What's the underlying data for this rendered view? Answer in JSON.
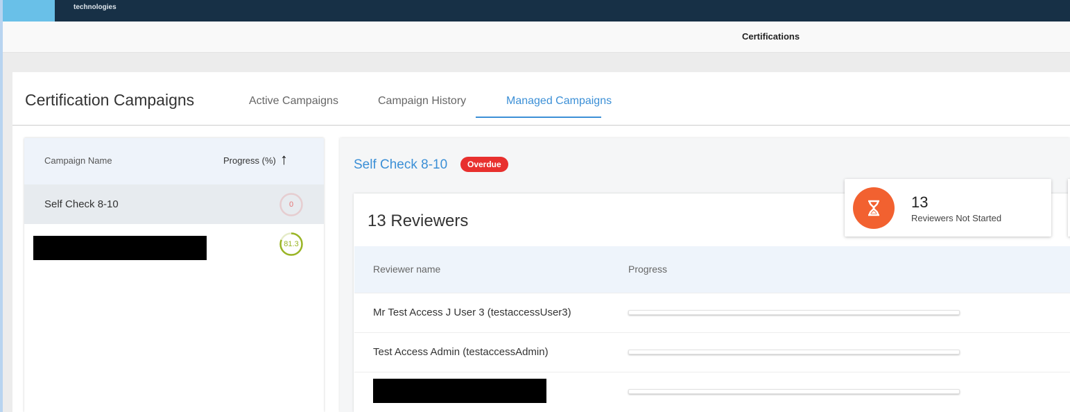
{
  "header": {
    "logo_text": "technologies",
    "section_title": "Certifications"
  },
  "page": {
    "title": "Certification Campaigns",
    "tabs": [
      {
        "label": "Active Campaigns"
      },
      {
        "label": "Campaign History"
      },
      {
        "label": "Managed Campaigns",
        "active": true
      }
    ]
  },
  "campaign_list": {
    "columns": {
      "name": "Campaign Name",
      "progress": "Progress (%)"
    },
    "sort_icon": "arrow-up-icon",
    "rows": [
      {
        "name": "Self Check 8-10",
        "progress": "0",
        "progress_value": 0,
        "color": "#e57373"
      },
      {
        "name": null,
        "redacted": true,
        "progress": "81.3",
        "progress_value": 81.3,
        "color": "#9ab526"
      }
    ]
  },
  "detail": {
    "campaign_title": "Self Check 8-10",
    "status_badge": "Overdue",
    "reviewers_title": "13 Reviewers",
    "stat": {
      "value": "13",
      "label": "Reviewers Not Started",
      "icon": "hourglass-icon",
      "color": "#f26130"
    },
    "columns": {
      "name": "Reviewer name",
      "progress": "Progress"
    },
    "reviewers": [
      {
        "name": "Mr Test Access J User 3 (testaccessUser3)",
        "progress": 0
      },
      {
        "name": "Test Access Admin (testaccessAdmin)",
        "progress": 0
      },
      {
        "name": null,
        "redacted": true,
        "progress": 0
      }
    ]
  }
}
